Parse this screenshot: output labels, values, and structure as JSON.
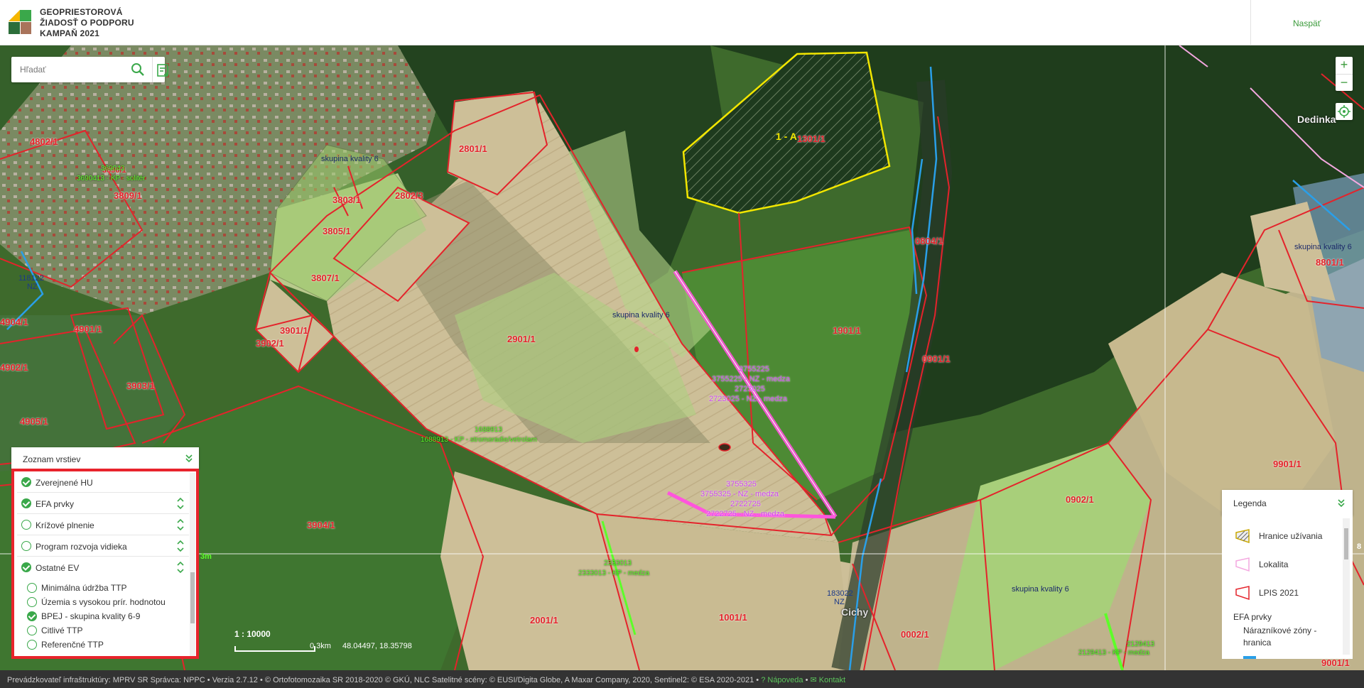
{
  "header": {
    "brand_line1": "GEOPRIESTOROVÁ",
    "brand_line2": "ŽIADOSŤ O PODPORU",
    "brand_line3": "KAMPAŇ 2021",
    "back_label": "Naspäť",
    "logo_colors": [
      "#f5b600",
      "#3aa84a",
      "#2c6e3a",
      "#a9745b"
    ]
  },
  "search": {
    "placeholder": "Hľadať",
    "search_icon": "search-icon",
    "filter_icon": "filter-list-icon"
  },
  "zoom": {
    "in_label": "+",
    "out_label": "−"
  },
  "map": {
    "parcel_labels": [
      "3810/1",
      "4802/1",
      "3690/1",
      "3809/1",
      "3803/1",
      "3805/1",
      "3807/1",
      "2801/1",
      "2802/3",
      "1301/1",
      "0804/1",
      "1901/1",
      "0901/1",
      "2901/1",
      "3901/1",
      "3902/1",
      "3903/1",
      "4901/1",
      "4904/1",
      "4902/1",
      "4905/1",
      "3904/1",
      "2001/1",
      "1001/1",
      "0002/1",
      "0902/1",
      "9901/1",
      "8801/1",
      "9001/1"
    ],
    "quality_labels": [
      "skupina kvality 6",
      "skupina kvality 6",
      "skupina kvality 6",
      "skupina kvality 6"
    ],
    "efa_labels": {
      "kp_solitar_id": "369043",
      "kp_solitar": "3690413 - KP - solitér",
      "kp_stromoradie_id": "1688913",
      "kp_stromoradie": "1688913 - KP - stromoradie/vetrolam",
      "kp_medza1_id": "2333013",
      "kp_medza1": "2333013 - KP - medza",
      "kp_medza2_id": "2129413",
      "kp_medza2": "2129413 - KP - medza",
      "nz_top_id1": "3755225",
      "nz_top1": "3755225 - NZ - medza",
      "nz_top_id2": "2723025",
      "nz_top2": "2723025 - NZ - medza",
      "nz_bot_id1": "3755325",
      "nz_bot1": "3755325 - NZ - medza",
      "nz_bot_id2": "2722725",
      "nz_bot2": "2722725 - NZ - medza",
      "nz_left_id": "118122",
      "nz_left": "NZ",
      "nz_south_id": "183022",
      "nz_south": "NZ"
    },
    "usage_label": "1 - A",
    "place_labels": {
      "dedinka": "Dedinka",
      "cichy": "Cichy"
    },
    "edge_label_bm": "3m",
    "edge_label_8": "8",
    "colors": {
      "lpis_red": "#e4232b",
      "usage_yellow": "#f2e600",
      "efa_pink": "#ff55dd",
      "kp_green": "#5dff29",
      "nz_blue": "#2a9fe8",
      "lokalita_pink": "#f4a8e0"
    }
  },
  "layers": {
    "title": "Zoznam vrstiev",
    "items": [
      {
        "label": "Zverejnené HU",
        "checked": true
      },
      {
        "label": "EFA prvky",
        "checked": true
      },
      {
        "label": "Krížové plnenie",
        "checked": false
      },
      {
        "label": "Program rozvoja vidieka",
        "checked": false
      },
      {
        "label": "Ostatné EV",
        "checked": true
      }
    ],
    "subitems": [
      {
        "label": "Minimálna údržba TTP",
        "checked": false
      },
      {
        "label": "Územia s vysokou prír. hodnotou",
        "checked": false
      },
      {
        "label": "BPEJ - skupina kvality 6-9",
        "checked": true
      },
      {
        "label": "Citlivé TTP",
        "checked": false
      },
      {
        "label": "Referenčné TTP",
        "checked": false
      }
    ]
  },
  "scale": {
    "ratio": "1 : 10000",
    "length": "0.3km",
    "coords": "48.04497, 18.35798"
  },
  "legend": {
    "title": "Legenda",
    "items": [
      {
        "label": "Hranice užívania",
        "icon": "hatched-yellow-polygon-icon"
      },
      {
        "label": "Lokalita",
        "icon": "pink-polygon-icon"
      },
      {
        "label": "LPIS 2021",
        "icon": "red-polygon-icon"
      }
    ],
    "group": "EFA prvky",
    "sub_label": "Nárazníkové zóny - hranica"
  },
  "footer": {
    "provider": "Prevádzkovateľ infraštruktúry: MPRV SR Správca: NPPC",
    "version": "Verzia 2.7.12",
    "copyright": "© Ortofotomozaika SR 2018-2020 © GKÚ, NLC Satelitné scény: © EUSI/Digita Globe, A Maxar Company, 2020, Sentinel2: © ESA 2020-2021",
    "help": "Nápoveda",
    "contact": "Kontakt"
  }
}
